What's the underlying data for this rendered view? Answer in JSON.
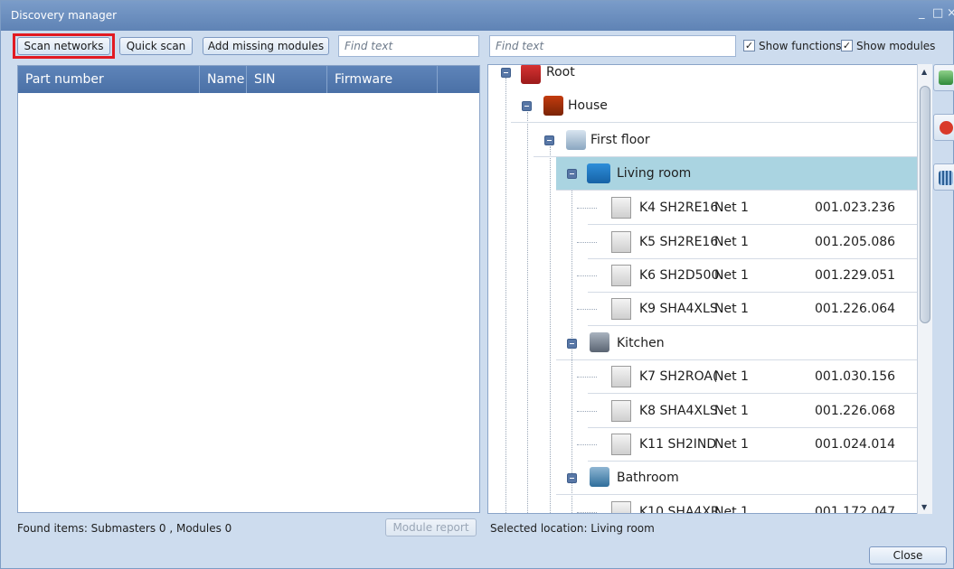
{
  "window": {
    "title": "Discovery manager"
  },
  "toolbar": {
    "scan_networks": "Scan networks",
    "quick_scan": "Quick scan",
    "add_missing": "Add missing modules",
    "find_left_placeholder": "Find text",
    "find_right_placeholder": "Find text",
    "show_functions": "Show functions",
    "show_modules": "Show modules"
  },
  "grid": {
    "columns": [
      "Part number",
      "Name",
      "SIN",
      "Firmware revision"
    ]
  },
  "left_status": {
    "found": "Found items: Submasters 0 , Modules 0",
    "module_report": "Module report"
  },
  "right_status": {
    "selected": "Selected location: Living room"
  },
  "tree": {
    "root": "Root",
    "house": "House",
    "first_floor": "First floor",
    "living_room": "Living room",
    "kitchen": "Kitchen",
    "bathroom": "Bathroom",
    "modules": [
      {
        "code": "K4 SH2RE16",
        "net": "Net 1",
        "sin": "001.023.236"
      },
      {
        "code": "K5 SH2RE16",
        "net": "Net 1",
        "sin": "001.205.086"
      },
      {
        "code": "K6 SH2D500",
        "net": "Net 1",
        "sin": "001.229.051"
      },
      {
        "code": "K9 SHA4XLS",
        "net": "Net 1",
        "sin": "001.226.064"
      },
      {
        "code": "K7 SH2ROA(",
        "net": "Net 1",
        "sin": "001.030.156"
      },
      {
        "code": "K8 SHA4XLS",
        "net": "Net 1",
        "sin": "001.226.068"
      },
      {
        "code": "K11 SH2IND",
        "net": "Net 1",
        "sin": "001.024.014"
      },
      {
        "code": "K10 SHA4XR",
        "net": "Net 1",
        "sin": "001.172.047"
      }
    ]
  },
  "footer": {
    "close": "Close"
  },
  "colors": {
    "selected_row": "#aad4e1",
    "header": "#5e84b9",
    "highlight": "#e21a22"
  }
}
